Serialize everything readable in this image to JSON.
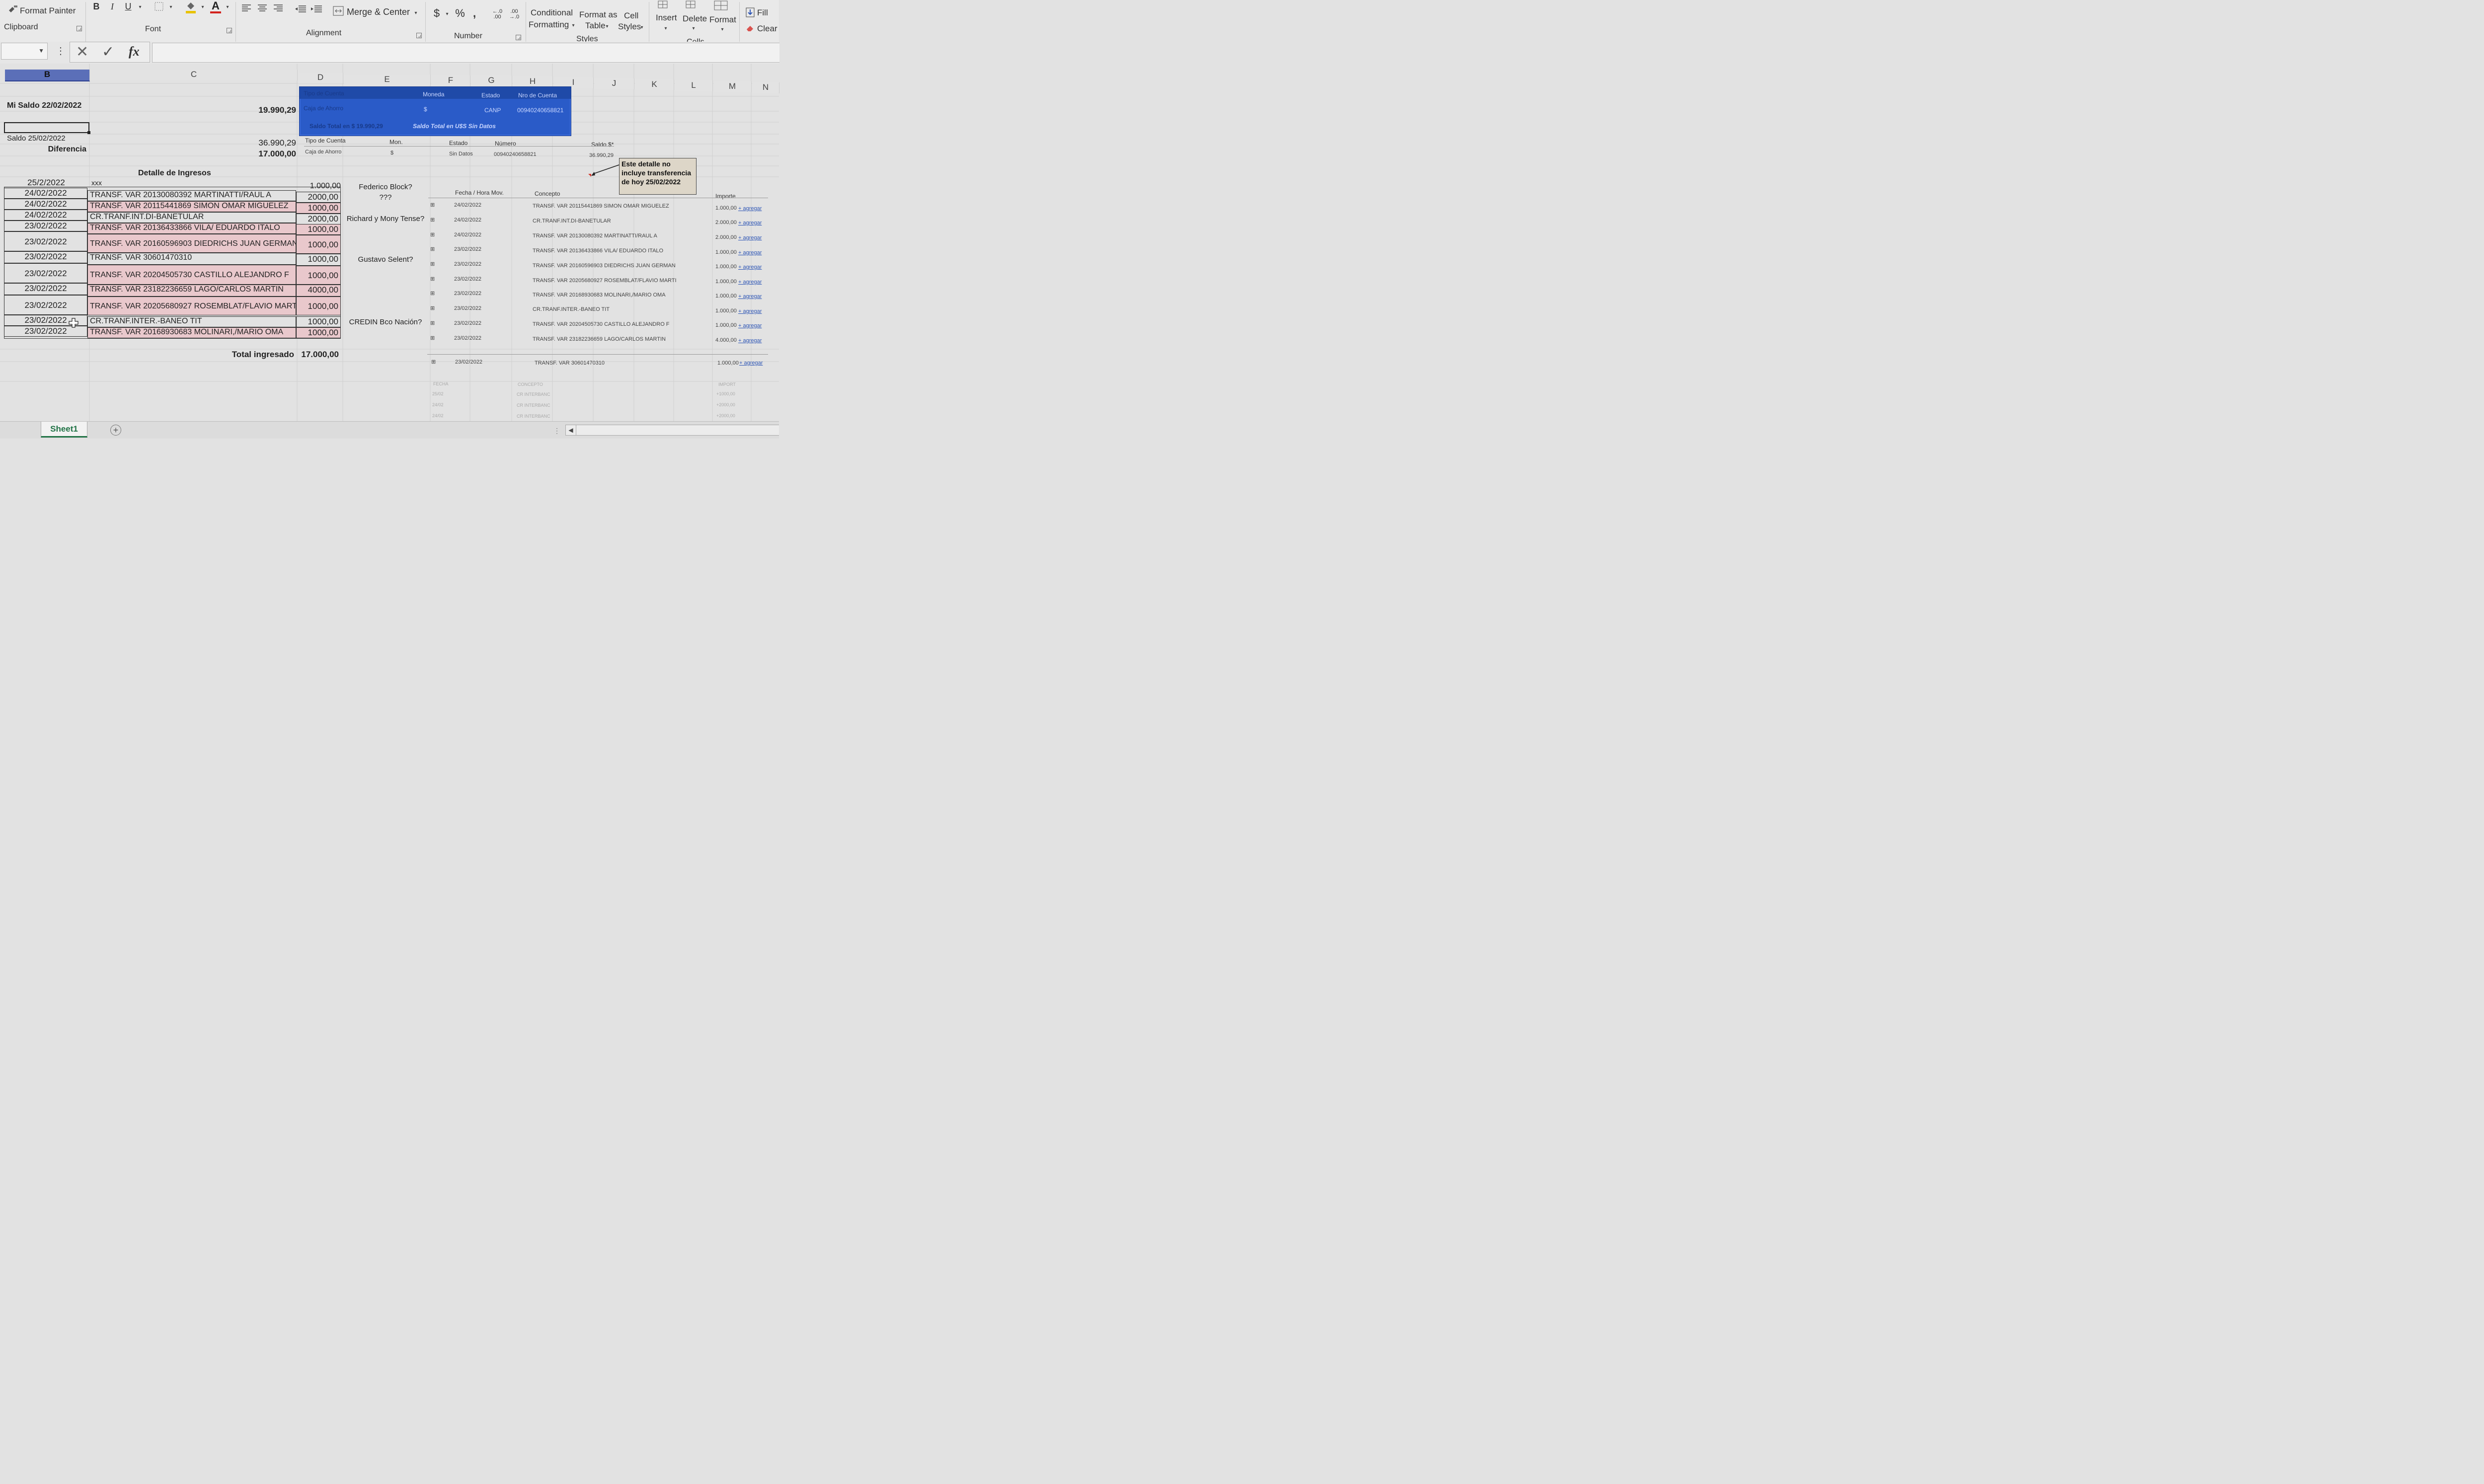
{
  "ribbon": {
    "clipboard": {
      "format_painter": "Format Painter",
      "group": "Clipboard"
    },
    "font": {
      "bold": "B",
      "italic": "I",
      "underline": "U",
      "font_color_glyph": "A",
      "group": "Font"
    },
    "alignment": {
      "merge_center": "Merge & Center",
      "group": "Alignment"
    },
    "number": {
      "currency": "$",
      "percent": "%",
      "comma": ",",
      "inc_decimal": "←.0 .00",
      "dec_decimal": ".00 →.0",
      "group": "Number"
    },
    "styles": {
      "conditional_formatting_1": "Conditional",
      "conditional_formatting_2": "Formatting",
      "format_table_1": "Format as",
      "format_table_2": "Table",
      "cell_styles_1": "Cell",
      "cell_styles_2": "Styles",
      "group": "Styles"
    },
    "cells": {
      "insert": "Insert",
      "delete": "Delete",
      "format": "Format",
      "group": "Cells"
    },
    "editing": {
      "fill": "Fill",
      "clear": "Clear"
    }
  },
  "formula_bar": {
    "fx": "fx",
    "cancel": "✕",
    "enter": "✓",
    "dots": "⋮"
  },
  "columns": [
    "B",
    "C",
    "D",
    "E",
    "F",
    "G",
    "H",
    "I",
    "J",
    "K",
    "L",
    "M",
    "N"
  ],
  "summary": {
    "mi_saldo_label": "Mi Saldo 22/02/2022",
    "mi_saldo_value": "19.990,29",
    "saldo_label": "Saldo 25/02/2022",
    "saldo_value": "36.990,29",
    "diferencia_label": "Diferencia",
    "diferencia_value": "17.000,00"
  },
  "blue_panel": {
    "headers": [
      "Tipo de Cuenta",
      "Moneda",
      "Estado",
      "Nro de Cuenta"
    ],
    "row": [
      "Caja de Ahorro",
      "$",
      "CANP",
      "00940240658821"
    ],
    "saldo_pesos": "Saldo Total en $ 19.990,29",
    "saldo_usd": "Saldo Total en U$S Sin Datos"
  },
  "account_table": {
    "headers": [
      "Tipo de Cuenta",
      "Mon.",
      "Estado",
      "Número",
      "Saldo $*"
    ],
    "row": [
      "Caja de Ahorro",
      "$",
      "Sin Datos",
      "00940240658821",
      "36.990,29"
    ]
  },
  "detail": {
    "title": "Detalle de Ingresos",
    "rows": [
      {
        "date": "25/2/2022",
        "desc": "xxx",
        "amount": "1.000,00",
        "note": "Federico Block?"
      },
      {
        "date": "24/02/2022",
        "desc": "TRANSF. VAR 20130080392 MARTINATTI/RAUL A",
        "amount": "2000,00",
        "note": "???"
      },
      {
        "date": "24/02/2022",
        "desc": "TRANSF. VAR 20115441869 SIMON OMAR MIGUELEZ",
        "amount": "1000,00",
        "note": ""
      },
      {
        "date": "24/02/2022",
        "desc": "CR.TRANF.INT.DI-BANETULAR",
        "amount": "2000,00",
        "note": "Richard y Mony Tense?"
      },
      {
        "date": "23/02/2022",
        "desc": "TRANSF. VAR 20136433866 VILA/ EDUARDO ITALO",
        "amount": "1000,00",
        "note": ""
      },
      {
        "date": "23/02/2022",
        "desc": "TRANSF. VAR 20160596903 DIEDRICHS JUAN GERMAN",
        "amount": "1000,00",
        "note": ""
      },
      {
        "date": "23/02/2022",
        "desc": "TRANSF. VAR 30601470310",
        "amount": "1000,00",
        "note": "Gustavo Selent?"
      },
      {
        "date": "23/02/2022",
        "desc": "TRANSF. VAR 20204505730 CASTILLO ALEJANDRO F",
        "amount": "1000,00",
        "note": ""
      },
      {
        "date": "23/02/2022",
        "desc": "TRANSF. VAR 23182236659 LAGO/CARLOS MARTIN",
        "amount": "4000,00",
        "note": ""
      },
      {
        "date": "23/02/2022",
        "desc": "TRANSF. VAR 20205680927 ROSEMBLAT/FLAVIO MARTI",
        "amount": "1000,00",
        "note": ""
      },
      {
        "date": "23/02/2022",
        "desc": "CR.TRANF.INTER.-BANEO TIT",
        "amount": "1000,00",
        "note": "CREDIN Bco Nación?"
      },
      {
        "date": "23/02/2022",
        "desc": "TRANSF. VAR 20168930683 MOLINARI,/MARIO OMA",
        "amount": "1000,00",
        "note": ""
      }
    ],
    "total_label": "Total ingresado",
    "total_value": "17.000,00"
  },
  "comment": "Este detalle no incluye transferencia de hoy 25/02/2022",
  "movements": {
    "headers": [
      "Fecha / Hora Mov.",
      "Concepto",
      "Importe"
    ],
    "rows": [
      {
        "date": "24/02/2022",
        "concept": "TRANSF. VAR 20115441869 SIMON OMAR MIGUELEZ",
        "amount": "1.000,00"
      },
      {
        "date": "24/02/2022",
        "concept": "CR.TRANF.INT.DI-BANETULAR",
        "amount": "2.000,00"
      },
      {
        "date": "24/02/2022",
        "concept": "TRANSF. VAR 20130080392 MARTINATTI/RAUL A",
        "amount": "2.000,00"
      },
      {
        "date": "23/02/2022",
        "concept": "TRANSF. VAR 20136433866 VILA/ EDUARDO ITALO",
        "amount": "1.000,00"
      },
      {
        "date": "23/02/2022",
        "concept": "TRANSF. VAR 20160596903 DIEDRICHS JUAN GERMAN",
        "amount": "1.000,00"
      },
      {
        "date": "23/02/2022",
        "concept": "TRANSF. VAR 20205680927 ROSEMBLAT/FLAVIO MARTI",
        "amount": "1.000,00"
      },
      {
        "date": "23/02/2022",
        "concept": "TRANSF. VAR 20168930683 MOLINARI,/MARIO OMA",
        "amount": "1.000,00"
      },
      {
        "date": "23/02/2022",
        "concept": "CR.TRANF.INTER.-BANEO TIT",
        "amount": "1.000,00"
      },
      {
        "date": "23/02/2022",
        "concept": "TRANSF. VAR 20204505730 CASTILLO ALEJANDRO F",
        "amount": "1.000,00"
      },
      {
        "date": "23/02/2022",
        "concept": "TRANSF. VAR 23182236659 LAGO/CARLOS MARTIN",
        "amount": "4.000,00"
      }
    ],
    "extra_row": {
      "date": "23/02/2022",
      "concept": "TRANSF. VAR 30601470310",
      "amount": "1.000,00"
    },
    "agregar": "+ agregar"
  },
  "faint_table": {
    "headers": [
      "FECHA",
      "CONCEPTO",
      "IMPORT"
    ],
    "rows": [
      {
        "date": "25/02",
        "concept": "CR INTERBANC",
        "amount": "+1000,00"
      },
      {
        "date": "24/02",
        "concept": "CR INTERBANC",
        "amount": "+2000,00"
      },
      {
        "date": "24/02",
        "concept": "CR INTERBANC",
        "amount": "+2000,00"
      }
    ]
  },
  "sheet_tab": "Sheet1",
  "colors": {
    "blue_panel": "#2a5bc8",
    "pink_cell": "#e9c8cc",
    "selected_header": "#5b6fb8",
    "link": "#2d55b5"
  }
}
